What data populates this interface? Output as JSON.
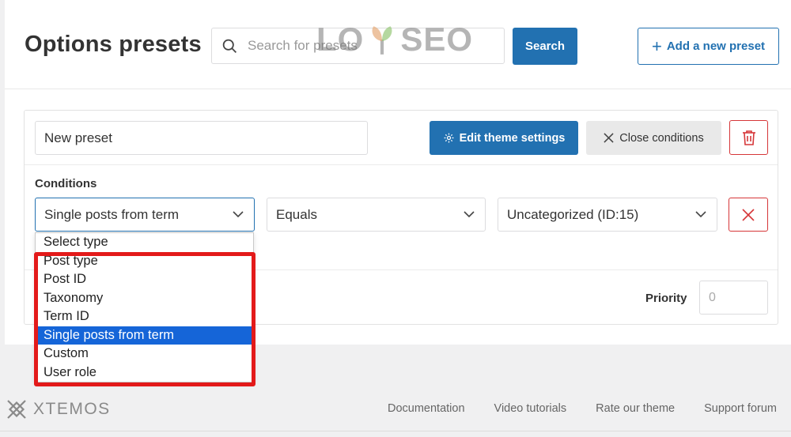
{
  "page": {
    "title": "Options presets"
  },
  "watermark": {
    "text_left": "LO",
    "text_right": "SEO"
  },
  "search": {
    "placeholder": "Search for presets",
    "button_label": "Search"
  },
  "add_preset": {
    "label": "Add a new preset"
  },
  "preset": {
    "name_value": "New preset",
    "edit_button": "Edit theme settings",
    "close_button": "Close conditions",
    "conditions_label": "Conditions",
    "condition": {
      "type_value": "Single posts from term",
      "comparison_value": "Equals",
      "value": "Uncategorized (ID:15)"
    },
    "priority_label": "Priority",
    "priority_placeholder": "0"
  },
  "type_dropdown": {
    "options": [
      "Select type",
      "Post type",
      "Post ID",
      "Taxonomy",
      "Term ID",
      "Single posts from term",
      "Custom",
      "User role"
    ],
    "selected": "Single posts from term"
  },
  "footer": {
    "brand": "XTEMOS",
    "links": [
      "Documentation",
      "Video tutorials",
      "Rate our theme",
      "Support forum"
    ]
  },
  "colors": {
    "primary": "#2271b1",
    "danger": "#d63638",
    "highlight": "#e31a1a",
    "selected_option": "#1565d8"
  }
}
